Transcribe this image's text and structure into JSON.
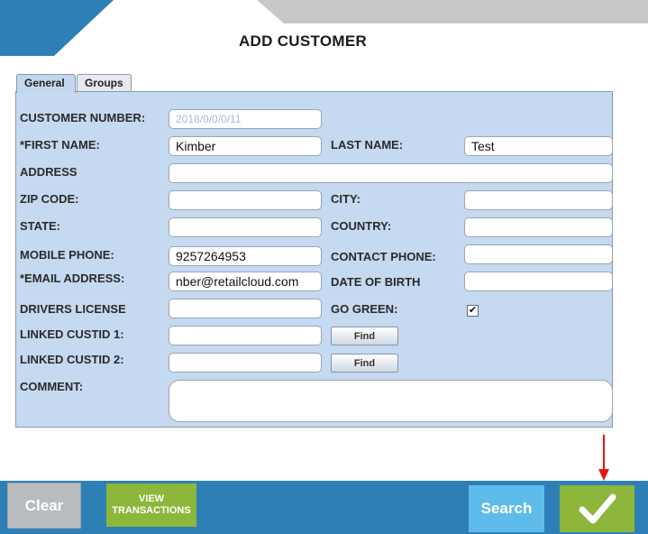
{
  "page": {
    "title": "ADD CUSTOMER"
  },
  "colors": {
    "accent_blue": "#2f7fb7",
    "panel_blue": "#c5d9f0",
    "green": "#8db63a",
    "search_blue": "#5fbcea",
    "grey": "#b9bcbf",
    "arrow_red": "#e8140f"
  },
  "tabs": [
    {
      "label": "General",
      "active": true
    },
    {
      "label": "Groups",
      "active": false
    }
  ],
  "form": {
    "customer_number": {
      "label": "CUSTOMER NUMBER:",
      "value": "2018/0/0/0/11"
    },
    "first_name": {
      "label": "*FIRST NAME:",
      "value": "Kimber"
    },
    "last_name": {
      "label": "LAST NAME:",
      "value": "Test"
    },
    "address": {
      "label": "ADDRESS",
      "value": ""
    },
    "zip_code": {
      "label": "ZIP CODE:",
      "value": ""
    },
    "city": {
      "label": "CITY:",
      "value": ""
    },
    "state": {
      "label": "STATE:",
      "value": ""
    },
    "country": {
      "label": "COUNTRY:",
      "value": ""
    },
    "mobile_phone": {
      "label": "MOBILE PHONE:",
      "value": "9257264953"
    },
    "contact_phone": {
      "label": "CONTACT PHONE:",
      "value": ""
    },
    "email": {
      "label": "*EMAIL ADDRESS:",
      "value": "nber@retailcloud.com"
    },
    "date_of_birth": {
      "label": "DATE OF BIRTH",
      "value": ""
    },
    "drivers_license": {
      "label": "DRIVERS LICENSE",
      "value": ""
    },
    "go_green": {
      "label": "GO GREEN:",
      "checked": true,
      "mark": "✔"
    },
    "linked_custid_1": {
      "label": "LINKED CUSTID 1:",
      "value": "",
      "button": "Find"
    },
    "linked_custid_2": {
      "label": "LINKED CUSTID 2:",
      "value": "",
      "button": "Find"
    },
    "comment": {
      "label": "COMMENT:",
      "value": ""
    }
  },
  "actions": {
    "clear": "Clear",
    "view_transactions_line1": "VIEW",
    "view_transactions_line2": "TRANSACTIONS",
    "search": "Search",
    "confirm_icon": "checkmark-icon"
  }
}
